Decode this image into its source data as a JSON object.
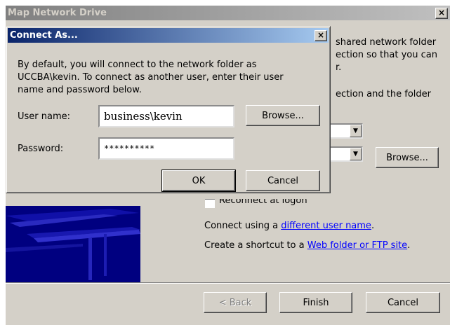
{
  "wizard": {
    "title": "Map Network Drive",
    "close_glyph": "×",
    "intro_line1": "shared network folder",
    "intro_line2": "ection so that you can",
    "intro_line3": "r.",
    "intro_line4": "ection and the folder",
    "drive_dropdown_arrow": "▼",
    "folder_dropdown_arrow": "▼",
    "browse_label": "Browse...",
    "reconnect_label": "Reconnect at logon",
    "connect_prefix": "Connect using a ",
    "connect_link": "different user name",
    "connect_suffix": ".",
    "shortcut_prefix": "Create a shortcut to a ",
    "shortcut_link": "Web folder or FTP site",
    "shortcut_suffix": ".",
    "back_label": "< Back",
    "finish_label": "Finish",
    "cancel_label": "Cancel"
  },
  "dialog": {
    "title": "Connect As...",
    "close_glyph": "×",
    "description_line1": "By default, you will connect to the network folder as",
    "description_line2": "UCCBA\\kevin. To connect as another user, enter their user",
    "description_line3": "name and password below.",
    "username_label": "User name:",
    "username_value": "business\\kevin",
    "browse_label": "Browse...",
    "password_label": "Password:",
    "password_value": "**********",
    "ok_label": "OK",
    "cancel_label": "Cancel"
  }
}
